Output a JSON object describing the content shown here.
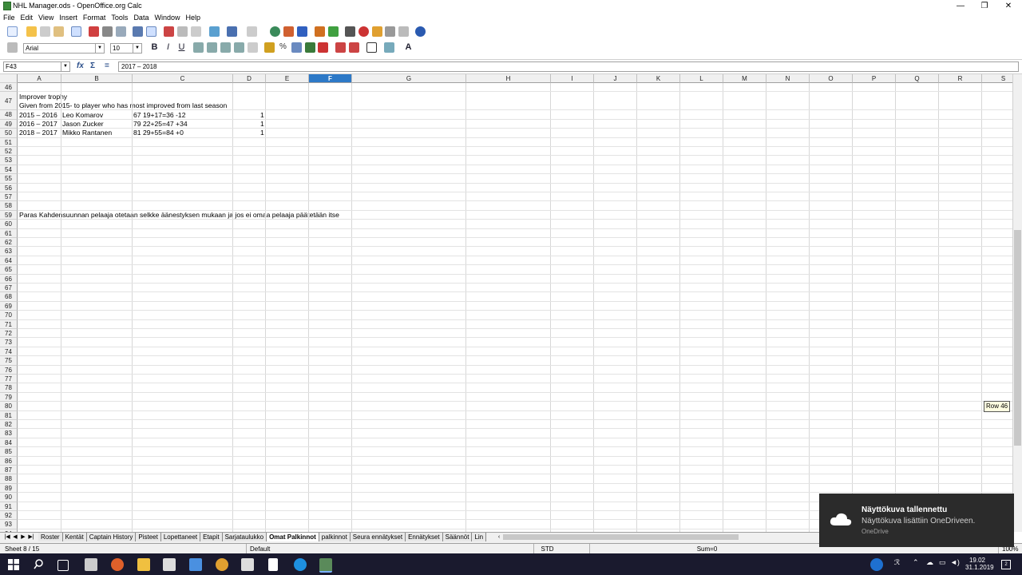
{
  "window": {
    "title": "NHL Manager.ods - OpenOffice.org Calc",
    "controls": {
      "minimize": "—",
      "restore": "❐",
      "close": "✕"
    }
  },
  "menu": [
    "File",
    "Edit",
    "View",
    "Insert",
    "Format",
    "Tools",
    "Data",
    "Window",
    "Help"
  ],
  "format_toolbar": {
    "font_name": "Arial",
    "font_size": "10"
  },
  "formula_bar": {
    "cell_ref": "F43",
    "content": "2017 – 2018"
  },
  "columns": [
    {
      "label": "A"
    },
    {
      "label": "B"
    },
    {
      "label": "C"
    },
    {
      "label": "D"
    },
    {
      "label": "E"
    },
    {
      "label": "F",
      "selected": true
    },
    {
      "label": "G"
    },
    {
      "label": "H"
    },
    {
      "label": "I"
    },
    {
      "label": "J"
    },
    {
      "label": "K"
    },
    {
      "label": "L"
    },
    {
      "label": "M"
    },
    {
      "label": "N"
    },
    {
      "label": "O"
    },
    {
      "label": "P"
    },
    {
      "label": "Q"
    },
    {
      "label": "R"
    },
    {
      "label": "S"
    },
    {
      "label": "T"
    }
  ],
  "rows": {
    "first": 46,
    "last": 94
  },
  "cells": {
    "a47_line1": "Improver trophy",
    "a47_line2": "Given from 2015- to player who has most improved from last season",
    "a48": "2015 – 2016",
    "b48": "Leo Komarov",
    "c48": "67 19+17=36 -12",
    "d48": "1",
    "a49": "2016 – 2017",
    "b49": "Jason Zucker",
    "c49": "79 22+25=47 +34",
    "d49": "1",
    "a50": "2018 – 2017",
    "b50": "Mikko Rantanen",
    "c50": "81 29+55=84 +0",
    "d50": "1",
    "a59": "Paras Kahdensuunnan pelaaja otetaan selkke äänestyksen mukaan ja jos ei omaa pelaaja päätetään itse"
  },
  "sheet_tabs": [
    {
      "label": "Roster"
    },
    {
      "label": "Kentät"
    },
    {
      "label": "Captain History"
    },
    {
      "label": "Pisteet"
    },
    {
      "label": "Lopettaneet"
    },
    {
      "label": "Etapit"
    },
    {
      "label": "Sarjataulukko"
    },
    {
      "label": "Omat Palkinnot",
      "active": true
    },
    {
      "label": "palkinnot"
    },
    {
      "label": "Seura ennätykset"
    },
    {
      "label": "Ennätykset"
    },
    {
      "label": "Säännöt"
    },
    {
      "label": "Lin"
    }
  ],
  "status": {
    "sheet": "Sheet 8 / 15",
    "style": "Default",
    "mode": "STD",
    "sum": "Sum=0",
    "zoom": "100%"
  },
  "tooltip": "Row 46",
  "notification": {
    "title": "Näyttökuva tallennettu",
    "body": "Näyttökuva lisättiin OneDriveen.",
    "source": "OneDrive"
  },
  "clock": {
    "time": "19.02",
    "date": "31.1.2019"
  },
  "colors": {
    "selected_col": "#2d79c7",
    "taskbar": "#1a1a2e",
    "toast": "#2b2b2b"
  }
}
